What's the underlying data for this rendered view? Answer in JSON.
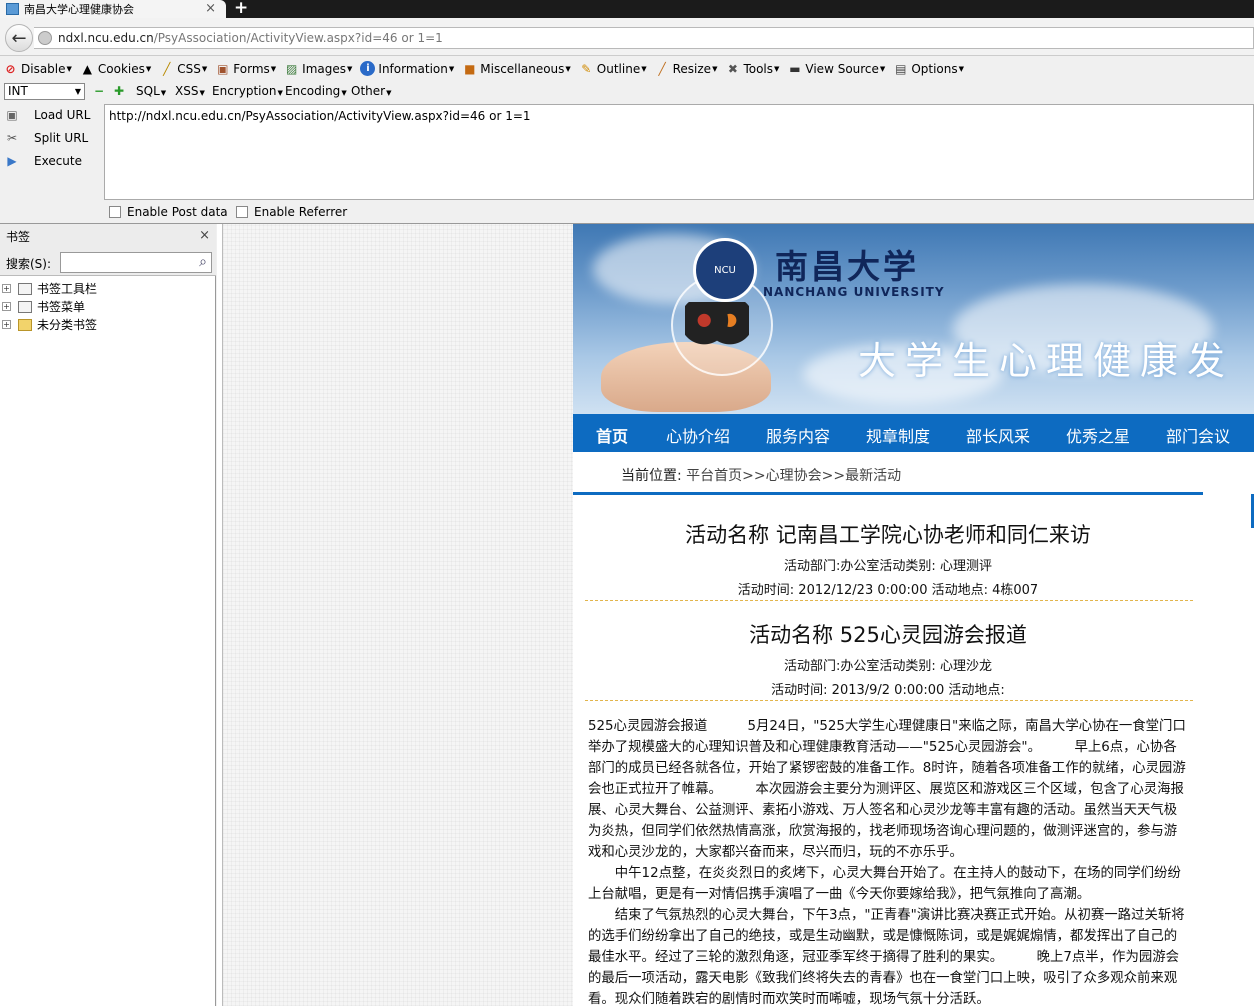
{
  "browser": {
    "tab_title": "南昌大学心理健康协会",
    "tab_close": "×",
    "new_tab": "+",
    "url_host": "ndxl.ncu.edu.cn",
    "url_rest": "/PsyAssociation/ActivityView.aspx?id=46 or 1=1"
  },
  "toolbar1": {
    "disable": "Disable",
    "cookies": "Cookies",
    "css": "CSS",
    "forms": "Forms",
    "images": "Images",
    "information": "Information",
    "miscellaneous": "Miscellaneous",
    "outline": "Outline",
    "resize": "Resize",
    "tools": "Tools",
    "view_source": "View Source",
    "options": "Options"
  },
  "toolbar2": {
    "select_value": "INT",
    "sql": "SQL",
    "xss": "XSS",
    "encryption": "Encryption",
    "encoding": "Encoding",
    "other": "Other"
  },
  "hackbar": {
    "load_url": "Load URL",
    "split_url": "Split URL",
    "execute": "Execute",
    "url_value": "http://ndxl.ncu.edu.cn/PsyAssociation/ActivityView.aspx?id=46 or 1=1",
    "enable_post": "Enable Post data",
    "enable_referrer": "Enable Referrer"
  },
  "sidebar": {
    "title": "书签",
    "close": "×",
    "search_label": "搜索(S):",
    "items": [
      "书签工具栏",
      "书签菜单",
      "未分类书签"
    ]
  },
  "site": {
    "seal_text": "NCU",
    "university_cn": "南昌大学",
    "university_en": "NANCHANG UNIVERSITY",
    "slogan": "大学生心理健康发",
    "nav": [
      "首页",
      "心协介绍",
      "服务内容",
      "规章制度",
      "部长风采",
      "优秀之星",
      "部门会议"
    ],
    "crumb_label": "当前位置:",
    "crumb_path": "平台首页>>心理协会>>最新活动",
    "activities": [
      {
        "title": "活动名称  记南昌工学院心协老师和同仁来访",
        "meta1": "活动部门:办公室活动类别: 心理测评",
        "meta2": "活动时间: 2012/12/23 0:00:00 活动地点: 4栋007"
      },
      {
        "title": "活动名称  525心灵园游会报道",
        "meta1": "活动部门:办公室活动类别: 心理沙龙",
        "meta2": "活动时间: 2013/9/2 0:00:00 活动地点:"
      }
    ],
    "article": [
      "525心灵园游会报道　　　5月24日，\"525大学生心理健康日\"来临之际，南昌大学心协在一食堂门口举办了规模盛大的心理知识普及和心理健康教育活动——\"525心灵园游会\"。　　　早上6点，心协各部门的成员已经各就各位，开始了紧锣密鼓的准备工作。8时许，随着各项准备工作的就绪，心灵园游会也正式拉开了帷幕。　　　本次园游会主要分为测评区、展览区和游戏区三个区域，包含了心灵海报展、心灵大舞台、公益测评、素拓小游戏、万人签名和心灵沙龙等丰富有趣的活动。虽然当天天气极为炎热，但同学们依然热情高涨，欣赏海报的，找老师现场咨询心理问题的，做测评迷宫的，参与游戏和心灵沙龙的，大家都兴奋而来，尽兴而归，玩的不亦乐乎。",
      "　　中午12点整，在炎炎烈日的炙烤下，心灵大舞台开始了。在主持人的鼓动下，在场的同学们纷纷上台献唱，更是有一对情侣携手演唱了一曲《今天你要嫁给我》，把气氛推向了高潮。",
      "　　结束了气氛热烈的心灵大舞台，下午3点，\"正青春\"演讲比赛决赛正式开始。从初赛一路过关斩将的选手们纷纷拿出了自己的绝技，或是生动幽默，或是慷慨陈词，或是娓娓煽情，都发挥出了自己的最佳水平。经过了三轮的激烈角逐，冠亚季军终于摘得了胜利的果实。　　　晚上7点半，作为园游会的最后一项活动，露天电影《致我们终将失去的青春》也在一食堂门口上映，吸引了众多观众前来观看。现众们随着跌宕的剧情时而欢笑时而唏嘘，现场气氛十分活跃。"
    ]
  }
}
